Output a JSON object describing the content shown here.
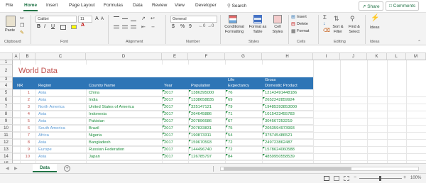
{
  "tabs": [
    "File",
    "Home",
    "Insert",
    "Page Layout",
    "Formulas",
    "Data",
    "Review",
    "View",
    "Developer"
  ],
  "search_label": "Search",
  "share_label": "Share",
  "comments_label": "Comments",
  "ribbon": {
    "paste_label": "Paste",
    "font_name": "Calibri",
    "font_size": "11",
    "bold": "B",
    "italic": "I",
    "underline": "U",
    "grow_font": "A",
    "shrink_font": "A",
    "number_format": "General",
    "currency": "$",
    "percent": "%",
    "comma": "9",
    "conditional_formatting": "Conditional\nFormatting",
    "format_as_table": "Format as\nTable",
    "cell_styles": "Cell\nStyles",
    "insert_label": "Insert",
    "delete_label": "Delete",
    "format_label": "Format",
    "sort_filter": "Sort &\nFilter",
    "find_select": "Find &\nSelect",
    "ideas": "Ideas",
    "groups": [
      "Clipboard",
      "Font",
      "Alignment",
      "Number",
      "Styles",
      "Cells",
      "Editing",
      "Ideas"
    ]
  },
  "columns": [
    "A",
    "B",
    "C",
    "D",
    "E",
    "F",
    "G",
    "H",
    "I",
    "J",
    "K",
    "L",
    "M"
  ],
  "rows": [
    "1",
    "2",
    "3",
    "4",
    "5",
    "6",
    "7",
    "8",
    "9",
    "10",
    "11",
    "12",
    "13",
    "14",
    "15"
  ],
  "sheet": {
    "title": "World Data",
    "headers": {
      "nr": "NR",
      "region": "Region",
      "country": "Country Name",
      "year": "Year",
      "population": "Population",
      "life_1": "Life",
      "life_2": "Expectancy",
      "gdp_1": "Gross",
      "gdp_2": "Domestic Product"
    },
    "data": [
      {
        "nr": "1",
        "region": "Asia",
        "country": "China",
        "year": "2017",
        "population": "1386395000",
        "life": "76",
        "gdp": "12143491448186"
      },
      {
        "nr": "2",
        "region": "Asia",
        "country": "India",
        "year": "2017",
        "population": "1338658835",
        "life": "69",
        "gdp": "2652242859924"
      },
      {
        "nr": "3",
        "region": "North America",
        "country": "United States of America",
        "year": "2017",
        "population": "325147121",
        "life": "79",
        "gdp": "19485393853000"
      },
      {
        "nr": "4",
        "region": "Asia",
        "country": "Indonesia",
        "year": "2017",
        "population": "264645886",
        "life": "71",
        "gdp": "1015423455783"
      },
      {
        "nr": "5",
        "region": "Asia",
        "country": "Pakistan",
        "year": "2017",
        "population": "207896686",
        "life": "67",
        "gdp": "304567253219"
      },
      {
        "nr": "6",
        "region": "South America",
        "country": "Brazil",
        "year": "2017",
        "population": "207833831",
        "life": "75",
        "gdp": "2053594973993"
      },
      {
        "nr": "7",
        "region": "Africa",
        "country": "Nigeria",
        "year": "2017",
        "population": "190873311",
        "life": "54",
        "gdp": "375745486521"
      },
      {
        "nr": "8",
        "region": "Asia",
        "country": "Bangladesh",
        "year": "2017",
        "population": "159670593",
        "life": "72",
        "gdp": "249723862487"
      },
      {
        "nr": "9",
        "region": "Europe",
        "country": "Russian Federation",
        "year": "2017",
        "population": "144496740",
        "life": "72",
        "gdp": "1578624060588"
      },
      {
        "nr": "10",
        "region": "Asia",
        "country": "Japan",
        "year": "2017",
        "population": "126785797",
        "life": "84",
        "gdp": "4859950558539"
      }
    ]
  },
  "sheet_tab": "Data",
  "zoom": "100%",
  "colors": {
    "accent": "#217346",
    "header_band": "#2e75b6",
    "title": "#c0504d",
    "region": "#5b9bd5",
    "value_green": "#1e8e3e"
  }
}
